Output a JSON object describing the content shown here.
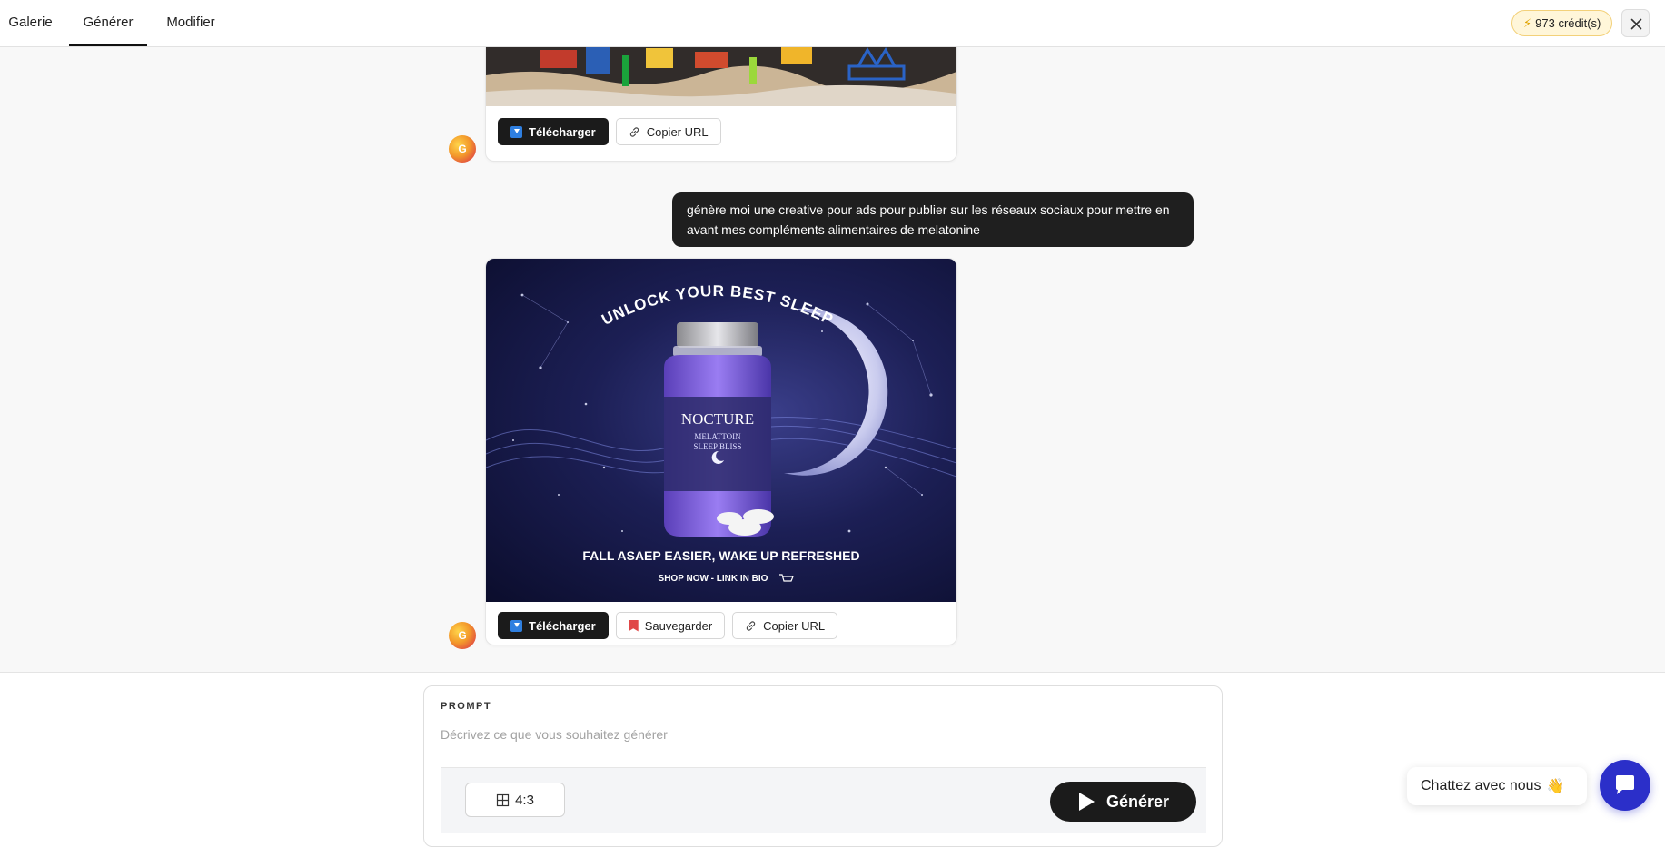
{
  "nav": {
    "tabs": [
      {
        "label": "Galerie",
        "active": false
      },
      {
        "label": "Générer",
        "active": true
      },
      {
        "label": "Modifier",
        "active": false
      }
    ],
    "credits": "973 crédit(s)"
  },
  "chat": {
    "avatar_letter": "G",
    "message_1": {
      "actions": {
        "download": "Télécharger",
        "copy_url": "Copier URL"
      }
    },
    "user_message": "génère moi une creative pour ads pour publier sur les réseaux sociaux pour mettre en avant mes compléments alimentaires de melatonine",
    "message_2": {
      "image_text": {
        "headline": "UNLOCK YOUR BEST SLEEP",
        "brand": "NOCTURE",
        "subtitle_1": "MELATTOIN",
        "subtitle_2": "SLEEP BLISS",
        "tagline": "FALL ASAEP EASIER, WAKE UP REFRESHED",
        "cta": "SHOP NOW - LINK IN BIO"
      },
      "actions": {
        "download": "Télécharger",
        "save": "Sauvegarder",
        "copy_url": "Copier URL"
      }
    }
  },
  "prompt": {
    "label": "PROMPT",
    "placeholder": "Décrivez ce que vous souhaitez générer",
    "value": "",
    "ratio": "4:3",
    "generate": "Générer"
  },
  "widget": {
    "chat_label": "Chattez avec nous",
    "emoji": "👋"
  },
  "colors": {
    "credits_bg": "#fff6d9",
    "dark": "#1b1b1b",
    "chat_fab": "#2b2fc9"
  }
}
